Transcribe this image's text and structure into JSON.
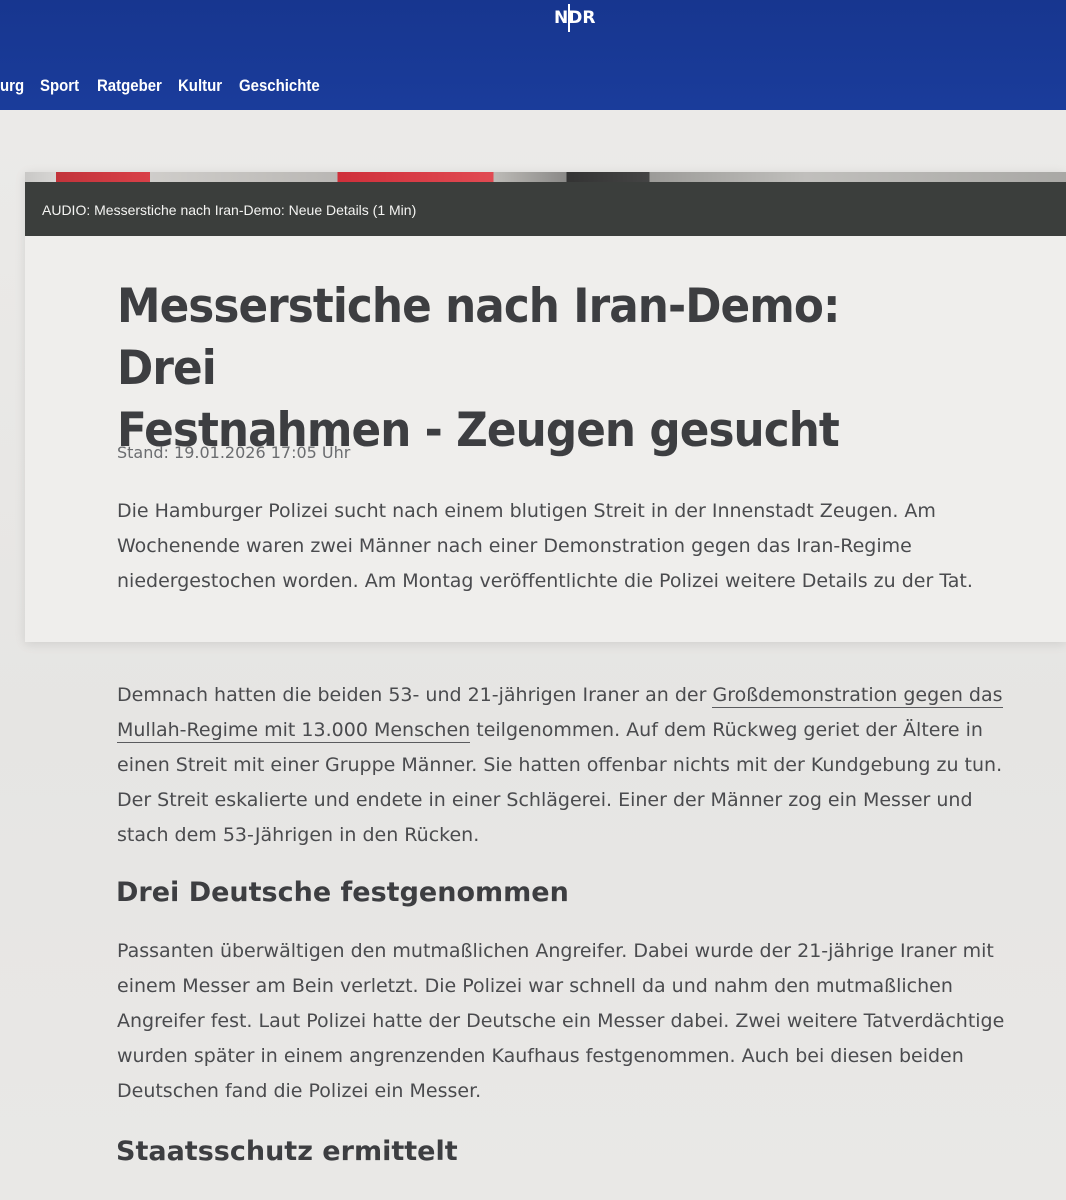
{
  "header": {
    "logo": "NDR",
    "nav": [
      {
        "label": "urg"
      },
      {
        "label": "Sport"
      },
      {
        "label": "Ratgeber"
      },
      {
        "label": "Kultur"
      },
      {
        "label": "Geschichte"
      }
    ]
  },
  "teaser": {
    "audio_label": "AUDIO: Messerstiche nach Iran-Demo: Neue Details (1 Min)",
    "title_line1": "Messerstiche nach Iran-Demo: Drei",
    "title_line2": "Festnahmen - Zeugen gesucht",
    "stand": "Stand: 19.01.2026 17:05 Uhr",
    "lead": "Die Hamburger Polizei sucht nach einem blutigen Streit in der Innenstadt Zeugen. Am Wochenende waren zwei Männer nach einer Demonstration gegen das Iran-Regime niedergestochen worden. Am Montag veröffentlichte die Polizei weitere Details zu der Tat."
  },
  "article": {
    "p1_before": "Demnach hatten die beiden 53- und 21-jährigen Iraner an der ",
    "p1_link": "Großdemonstration gegen das Mullah-Regime mit 13.000 Menschen",
    "p1_after": " teilgenommen. Auf dem Rückweg geriet der Ältere in einen Streit mit einer Gruppe Männer. Sie hatten offenbar nichts mit der Kundgebung zu tun. Der Streit eskalierte und endete in einer Schlägerei. Einer der Männer zog ein Messer und stach dem 53-Jährigen in den Rücken.",
    "h2_1": "Drei Deutsche festgenommen",
    "p2": "Passanten überwältigen den mutmaßlichen Angreifer. Dabei wurde der 21-jährige Iraner mit einem Messer am Bein verletzt. Die Polizei war schnell da und nahm den mutmaßlichen Angreifer fest. Laut Polizei hatte der Deutsche ein Messer dabei. Zwei weitere Tatverdächtige wurden später in einem angrenzenden Kaufhaus festgenommen. Auch bei diesen beiden Deutschen fand die Polizei ein Messer.",
    "h2_2": "Staatsschutz ermittelt"
  }
}
